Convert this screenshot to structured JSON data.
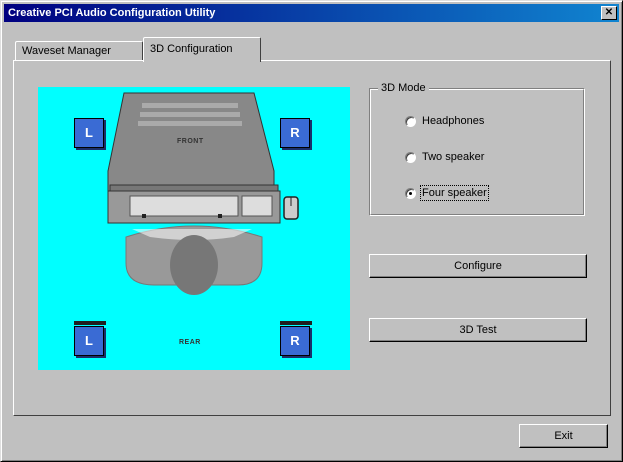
{
  "window": {
    "title": "Creative PCI Audio Configuration Utility",
    "close_glyph": "✕"
  },
  "tabs": [
    {
      "label": "Waveset Manager",
      "active": false
    },
    {
      "label": "3D Configuration",
      "active": true
    }
  ],
  "scene": {
    "background": "#00ffff",
    "speaker_color": "#3a6bd4",
    "front_label": "FRONT",
    "rear_label": "REAR",
    "speakers": {
      "front_left": "L",
      "front_right": "R",
      "rear_left": "L",
      "rear_right": "R"
    }
  },
  "mode_group": {
    "title": "3D Mode",
    "options": [
      {
        "label": "Headphones",
        "checked": false
      },
      {
        "label": "Two speaker",
        "checked": false
      },
      {
        "label": "Four speaker",
        "checked": true
      }
    ]
  },
  "buttons": {
    "configure": "Configure",
    "test": "3D Test",
    "exit": "Exit"
  }
}
